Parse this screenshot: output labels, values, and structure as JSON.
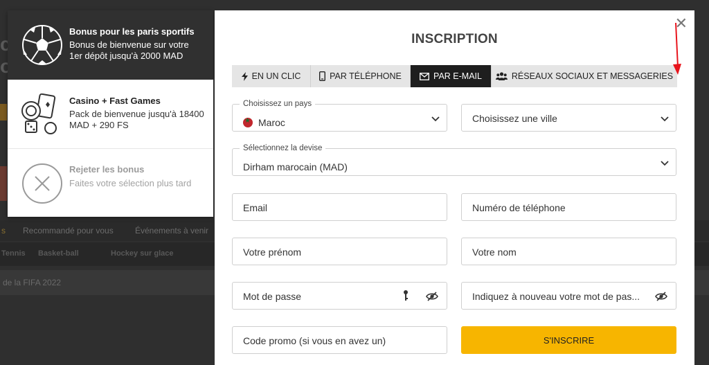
{
  "background": {
    "nav": [
      "Recommandé pour vous",
      "Événements à venir"
    ],
    "sports": [
      "Tennis",
      "Basket-ball",
      "Hockey sur glace"
    ],
    "row_text": "de la FIFA 2022"
  },
  "bonuses": [
    {
      "icon": "soccer-ball-icon",
      "title": "Bonus pour les paris sportifs",
      "desc": "Bonus de bienvenue sur votre 1er dépôt jusqu'à 2000 MAD",
      "active": true
    },
    {
      "icon": "casino-chips-icon",
      "title": "Casino + Fast Games",
      "desc": "Pack de bienvenue jusqu'à 18400 MAD + 290 FS",
      "active": false
    },
    {
      "icon": "reject-x-icon",
      "title": "Rejeter les bonus",
      "desc": "Faites votre sélection plus tard",
      "active": false
    }
  ],
  "modal": {
    "title": "INSCRIPTION",
    "close": "✕",
    "tabs": [
      {
        "label": "EN UN CLIC",
        "icon": "lightning-icon",
        "active": false
      },
      {
        "label": "PAR TÉLÉPHONE",
        "icon": "phone-icon",
        "active": false
      },
      {
        "label": "PAR E-MAIL",
        "icon": "envelope-icon",
        "active": true
      },
      {
        "label": "RÉSEAUX SOCIAUX ET MESSAGERIES",
        "icon": "users-icon",
        "active": false
      }
    ],
    "country": {
      "label": "Choisissez un pays",
      "value": "Maroc"
    },
    "city": {
      "placeholder": "Choisissez une ville"
    },
    "currency": {
      "label": "Sélectionnez la devise",
      "value": "Dirham marocain (MAD)"
    },
    "email": {
      "placeholder": "Email"
    },
    "phone": {
      "placeholder": "Numéro de téléphone"
    },
    "first_name": {
      "placeholder": "Votre prénom"
    },
    "last_name": {
      "placeholder": "Votre nom"
    },
    "password": {
      "placeholder": "Mot de passe"
    },
    "password_confirm": {
      "placeholder": "Indiquez à nouveau votre mot de pas..."
    },
    "promo": {
      "placeholder": "Code promo (si vous en avez un)"
    },
    "submit": "S'INSCRIRE"
  },
  "colors": {
    "accent": "#f7b500",
    "active_tab": "#1e1e1e",
    "arrow": "#e8141c"
  }
}
